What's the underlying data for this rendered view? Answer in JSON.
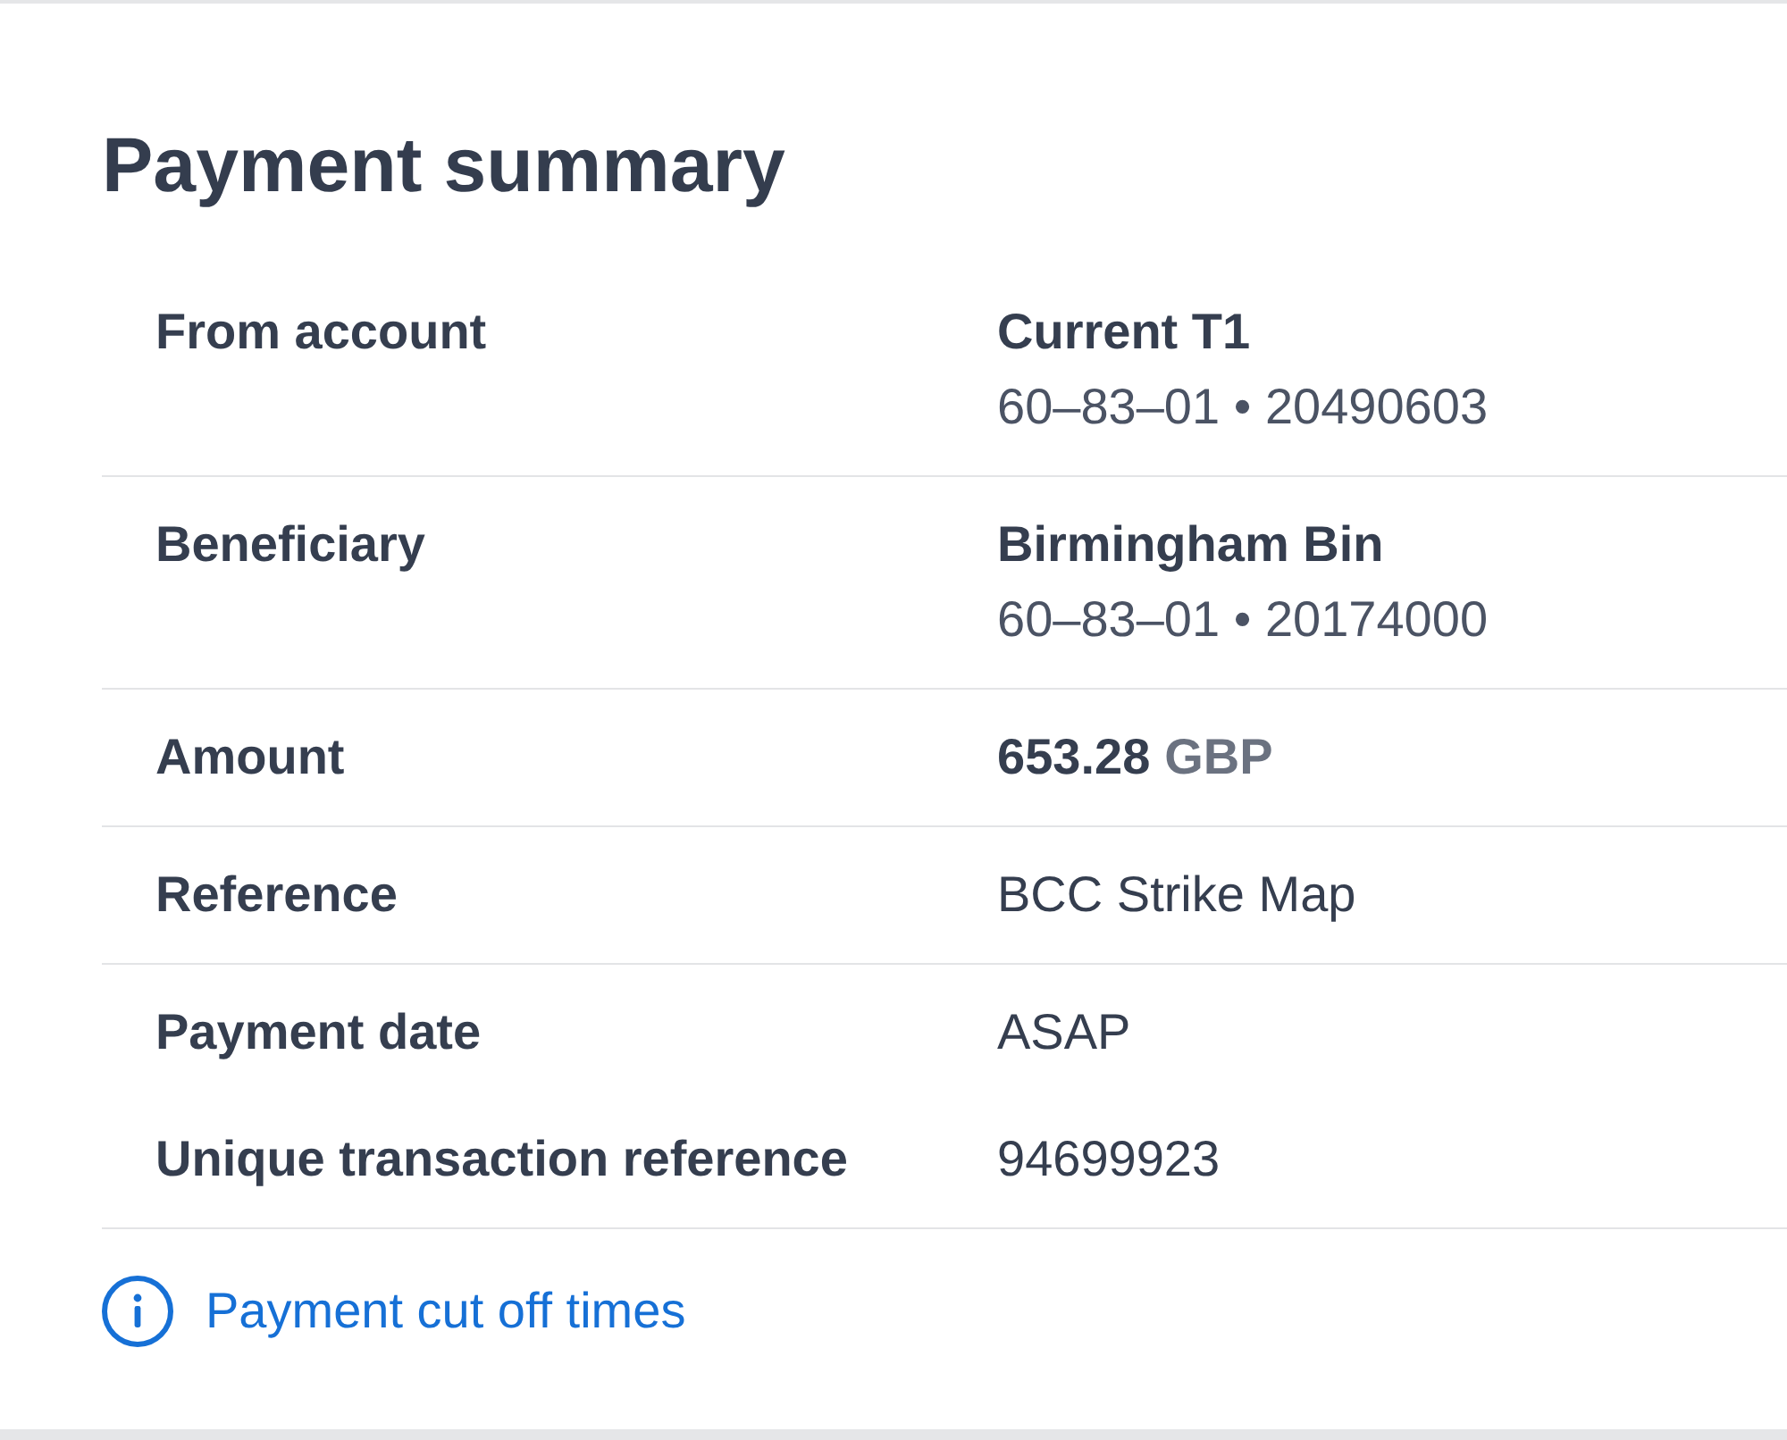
{
  "title": "Payment summary",
  "sections": [
    {
      "rows": [
        {
          "kind": "account",
          "label": "From account",
          "value": "Current T1",
          "detail": "60–83–01 • 20490603"
        }
      ]
    },
    {
      "rows": [
        {
          "kind": "account",
          "label": "Beneficiary",
          "value": "Birmingham Bin",
          "detail": "60–83–01 • 20174000"
        }
      ]
    },
    {
      "rows": [
        {
          "kind": "amount",
          "label": "Amount",
          "value": "653.28",
          "unit": "GBP"
        }
      ]
    },
    {
      "rows": [
        {
          "kind": "text",
          "label": "Reference",
          "value": "BCC Strike Map"
        }
      ]
    },
    {
      "rows": [
        {
          "kind": "text",
          "label": "Payment date",
          "value": "ASAP"
        },
        {
          "kind": "text",
          "label": "Unique transaction reference",
          "value": "94699923"
        }
      ]
    }
  ],
  "link": {
    "label": "Payment cut off times"
  }
}
